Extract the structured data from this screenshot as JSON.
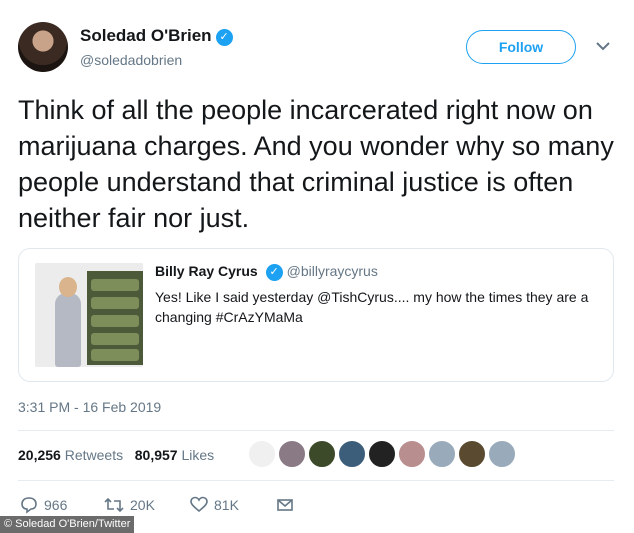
{
  "author": {
    "name": "Soledad O'Brien",
    "handle": "@soledadobrien",
    "verified": "✓"
  },
  "follow_label": "Follow",
  "tweet_text": "Think of all the people incarcerated right now on marijuana charges. And you wonder why so many people understand that criminal justice is often neither fair nor just.",
  "quoted": {
    "name": "Billy Ray Cyrus",
    "verified": "✓",
    "handle": "@billyraycyrus",
    "text": "Yes! Like I said yesterday @TishCyrus.... my how the times they are a changing #CrAzYMaMa"
  },
  "timestamp": "3:31 PM - 16 Feb 2019",
  "stats": {
    "retweets_count": "20,256",
    "retweets_label": "Retweets",
    "likes_count": "80,957",
    "likes_label": "Likes"
  },
  "liker_avatars": [
    "#f0f0f0",
    "#8a7a86",
    "#3d4a2a",
    "#3d5e7a",
    "#222222",
    "#b98e8e",
    "#99aabb",
    "#5a4a30",
    "#99aabb"
  ],
  "actions": {
    "replies": "966",
    "retweets": "20K",
    "likes": "81K"
  },
  "credit": "© Soledad O'Brien/Twitter",
  "accent_color": "#1da1f2"
}
